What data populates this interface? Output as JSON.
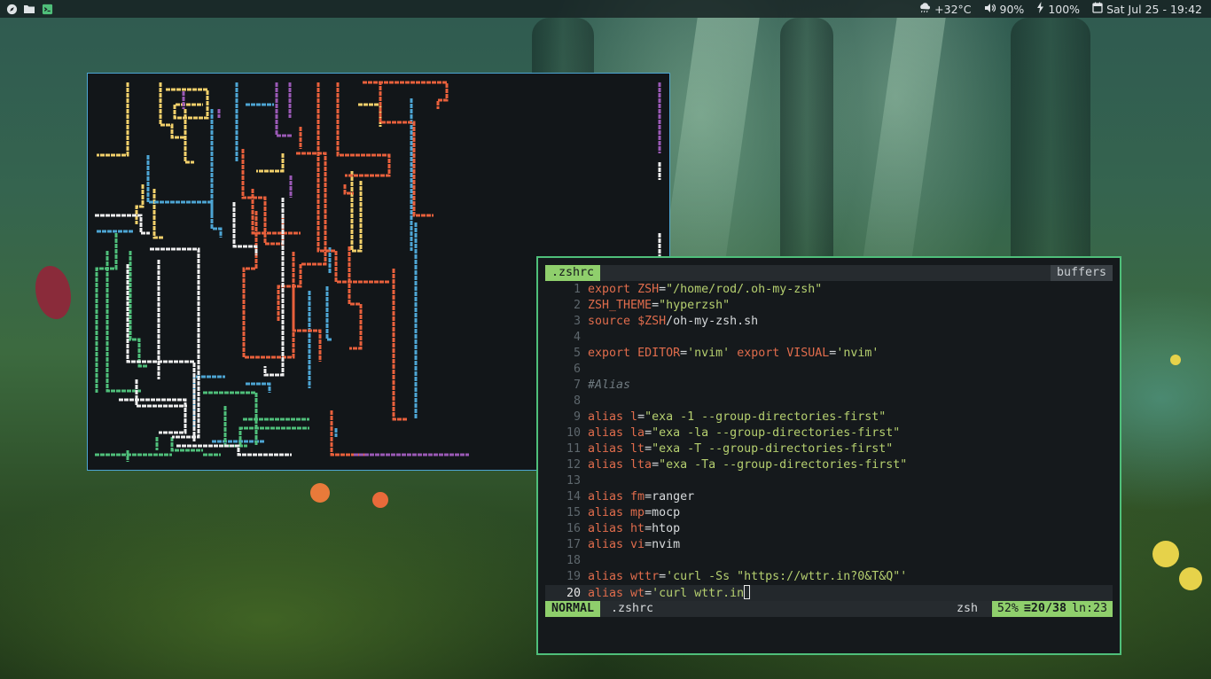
{
  "topbar": {
    "left_icons": [
      "compass-icon",
      "folder-icon",
      "terminal-icon"
    ],
    "weather": "+32°C",
    "volume": "90%",
    "battery": "100%",
    "datetime": "Sat Jul 25 - 19:42"
  },
  "pipes_window": {
    "program": "pipes",
    "colors": [
      "#f2d06b",
      "#4da5d4",
      "#e8603c",
      "#9b59b6",
      "#4fbf7a",
      "#eeeeee"
    ]
  },
  "nvim": {
    "tab_active": ".zshrc",
    "tab_right": "buffers",
    "lines": [
      {
        "n": "1",
        "segs": [
          {
            "c": "kw",
            "t": "export"
          },
          {
            "c": "txt",
            "t": " "
          },
          {
            "c": "kw",
            "t": "ZSH"
          },
          {
            "c": "txt",
            "t": "="
          },
          {
            "c": "str",
            "t": "\"/home/rod/.oh-my-zsh\""
          }
        ]
      },
      {
        "n": "2",
        "segs": [
          {
            "c": "kw",
            "t": "ZSH_THEME"
          },
          {
            "c": "txt",
            "t": "="
          },
          {
            "c": "str",
            "t": "\"hyperzsh\""
          }
        ]
      },
      {
        "n": "3",
        "segs": [
          {
            "c": "kw",
            "t": "source"
          },
          {
            "c": "txt",
            "t": " "
          },
          {
            "c": "kw",
            "t": "$ZSH"
          },
          {
            "c": "txt",
            "t": "/oh-my-zsh.sh"
          }
        ]
      },
      {
        "n": "4",
        "segs": []
      },
      {
        "n": "5",
        "segs": [
          {
            "c": "kw",
            "t": "export"
          },
          {
            "c": "txt",
            "t": " "
          },
          {
            "c": "kw",
            "t": "EDITOR"
          },
          {
            "c": "txt",
            "t": "="
          },
          {
            "c": "str",
            "t": "'nvim'"
          },
          {
            "c": "txt",
            "t": " "
          },
          {
            "c": "kw",
            "t": "export"
          },
          {
            "c": "txt",
            "t": " "
          },
          {
            "c": "kw",
            "t": "VISUAL"
          },
          {
            "c": "txt",
            "t": "="
          },
          {
            "c": "str",
            "t": "'nvim'"
          }
        ]
      },
      {
        "n": "6",
        "segs": []
      },
      {
        "n": "7",
        "segs": [
          {
            "c": "cmt",
            "t": "#Alias"
          }
        ]
      },
      {
        "n": "8",
        "segs": []
      },
      {
        "n": "9",
        "segs": [
          {
            "c": "kw",
            "t": "alias"
          },
          {
            "c": "txt",
            "t": " "
          },
          {
            "c": "kw",
            "t": "l"
          },
          {
            "c": "txt",
            "t": "="
          },
          {
            "c": "str",
            "t": "\"exa -1 --group-directories-first\""
          }
        ]
      },
      {
        "n": "10",
        "segs": [
          {
            "c": "kw",
            "t": "alias"
          },
          {
            "c": "txt",
            "t": " "
          },
          {
            "c": "kw",
            "t": "la"
          },
          {
            "c": "txt",
            "t": "="
          },
          {
            "c": "str",
            "t": "\"exa -la --group-directories-first\""
          }
        ]
      },
      {
        "n": "11",
        "segs": [
          {
            "c": "kw",
            "t": "alias"
          },
          {
            "c": "txt",
            "t": " "
          },
          {
            "c": "kw",
            "t": "lt"
          },
          {
            "c": "txt",
            "t": "="
          },
          {
            "c": "str",
            "t": "\"exa -T --group-directories-first\""
          }
        ]
      },
      {
        "n": "12",
        "segs": [
          {
            "c": "kw",
            "t": "alias"
          },
          {
            "c": "txt",
            "t": " "
          },
          {
            "c": "kw",
            "t": "lta"
          },
          {
            "c": "txt",
            "t": "="
          },
          {
            "c": "str",
            "t": "\"exa -Ta --group-directories-first\""
          }
        ]
      },
      {
        "n": "13",
        "segs": []
      },
      {
        "n": "14",
        "segs": [
          {
            "c": "kw",
            "t": "alias"
          },
          {
            "c": "txt",
            "t": " "
          },
          {
            "c": "kw",
            "t": "fm"
          },
          {
            "c": "txt",
            "t": "=ranger"
          }
        ]
      },
      {
        "n": "15",
        "segs": [
          {
            "c": "kw",
            "t": "alias"
          },
          {
            "c": "txt",
            "t": " "
          },
          {
            "c": "kw",
            "t": "mp"
          },
          {
            "c": "txt",
            "t": "=mocp"
          }
        ]
      },
      {
        "n": "16",
        "segs": [
          {
            "c": "kw",
            "t": "alias"
          },
          {
            "c": "txt",
            "t": " "
          },
          {
            "c": "kw",
            "t": "ht"
          },
          {
            "c": "txt",
            "t": "=htop"
          }
        ]
      },
      {
        "n": "17",
        "segs": [
          {
            "c": "kw",
            "t": "alias"
          },
          {
            "c": "txt",
            "t": " "
          },
          {
            "c": "kw",
            "t": "vi"
          },
          {
            "c": "txt",
            "t": "=nvim"
          }
        ]
      },
      {
        "n": "18",
        "segs": []
      },
      {
        "n": "19",
        "segs": [
          {
            "c": "kw",
            "t": "alias"
          },
          {
            "c": "txt",
            "t": " "
          },
          {
            "c": "kw",
            "t": "wttr"
          },
          {
            "c": "txt",
            "t": "="
          },
          {
            "c": "str",
            "t": "'curl -Ss \"https://wttr.in?0&T&Q\"'"
          }
        ]
      },
      {
        "n": "20",
        "segs": [
          {
            "c": "kw",
            "t": "alias"
          },
          {
            "c": "txt",
            "t": " "
          },
          {
            "c": "kw",
            "t": "wt"
          },
          {
            "c": "txt",
            "t": "="
          },
          {
            "c": "str",
            "t": "'curl wttr.in"
          }
        ],
        "cursor": true
      }
    ],
    "status": {
      "mode": "NORMAL",
      "file": ".zshrc",
      "filetype": "zsh",
      "percent": "52%",
      "line_pos": "≡20/38",
      "col_pos": "ln:23"
    }
  }
}
